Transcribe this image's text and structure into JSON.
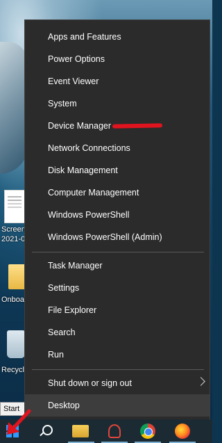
{
  "desktop": {
    "icons": [
      {
        "label": "Screen",
        "label2": "2021-0"
      },
      {
        "label": "Onboa"
      },
      {
        "label": "Recycl"
      }
    ],
    "start_tooltip": "Start"
  },
  "winx_menu": {
    "items": [
      {
        "label": "Apps and Features"
      },
      {
        "label": "Power Options"
      },
      {
        "label": "Event Viewer"
      },
      {
        "label": "System"
      },
      {
        "label": "Device Manager"
      },
      {
        "label": "Network Connections"
      },
      {
        "label": "Disk Management"
      },
      {
        "label": "Computer Management"
      },
      {
        "label": "Windows PowerShell"
      },
      {
        "label": "Windows PowerShell (Admin)"
      },
      {
        "label": "Task Manager"
      },
      {
        "label": "Settings"
      },
      {
        "label": "File Explorer"
      },
      {
        "label": "Search"
      },
      {
        "label": "Run"
      },
      {
        "label": "Shut down or sign out"
      },
      {
        "label": "Desktop"
      }
    ],
    "highlighted_item": "Device Manager",
    "selected_item": "Desktop"
  },
  "taskbar": {
    "apps": [
      "file-explorer",
      "snipping-tool",
      "chrome",
      "firefox"
    ]
  },
  "colors": {
    "menu_bg": "#2b2b2b",
    "menu_text": "#ffffff",
    "annotation": "#e0141e",
    "taskbar": "#1c2b33",
    "windows_blue": "#2e9bff"
  }
}
